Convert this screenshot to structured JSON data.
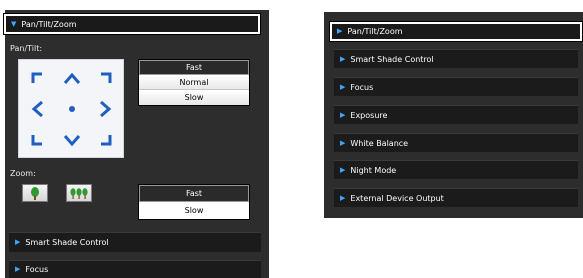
{
  "left_panel": {
    "header": "Pan/Tilt/Zoom",
    "pan_tilt_label": "Pan/Tilt:",
    "pan_tilt_speeds": [
      "Fast",
      "Normal",
      "Slow"
    ],
    "pan_tilt_selected": "Fast",
    "zoom_label": "Zoom:",
    "zoom_speeds": [
      "Fast",
      "Slow"
    ],
    "zoom_selected": "Fast",
    "sections": [
      "Smart Shade Control",
      "Focus"
    ]
  },
  "right_panel": {
    "header": "Pan/Tilt/Zoom",
    "sections": [
      "Smart Shade Control",
      "Focus",
      "Exposure",
      "White Balance",
      "Night Mode",
      "External Device Output"
    ]
  },
  "colors": {
    "panel_bg": "#2d2d2d",
    "bar_bg": "#1b1b1b",
    "accent_arrow": "#3ea6ff",
    "pad_arrow": "#1f5fbf",
    "zoom_icon": "#2f9a2f"
  },
  "icons": {
    "expanded": "triangle-down",
    "collapsed": "triangle-right",
    "zoom_wide": "single-tree",
    "zoom_tele": "three-trees"
  }
}
